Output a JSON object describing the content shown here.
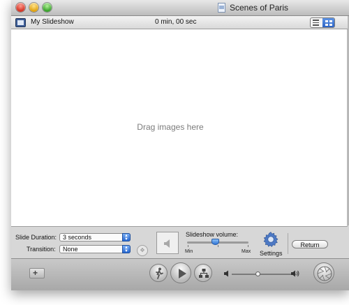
{
  "window": {
    "title": "Scenes of Paris"
  },
  "toolbar": {
    "slideshow_name": "My Slideshow",
    "total_duration": "0 min, 00 sec",
    "view_mode": "grid"
  },
  "content": {
    "placeholder": "Drag images here"
  },
  "controls": {
    "slide_duration": {
      "label": "Slide Duration:",
      "value": "3 seconds"
    },
    "transition": {
      "label": "Transition:",
      "value": "None"
    },
    "volume": {
      "label": "Slideshow volume:",
      "min_label": "Min",
      "max_label": "Max",
      "level": 0.45
    },
    "settings_label": "Settings",
    "return_label": "Return"
  },
  "bottom": {
    "add_label": "+",
    "playback_volume_level": 0.4
  }
}
